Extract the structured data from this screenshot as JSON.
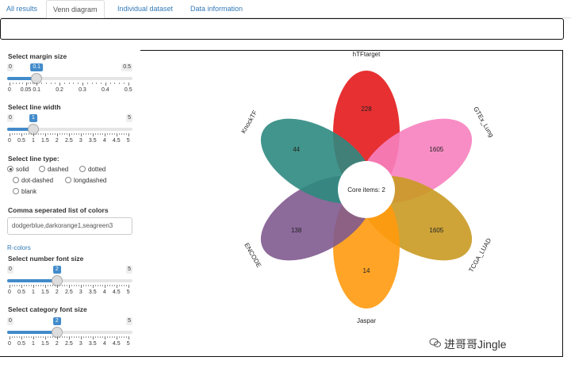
{
  "tabs": [
    "All results",
    "Venn diagram",
    "Individual dataset",
    "Data information"
  ],
  "active_tab": "Venn diagram",
  "margin_slider": {
    "label": "Select margin size",
    "min": "0",
    "max": "0.5",
    "value_label": "0.1",
    "value": 0.1,
    "range": [
      0,
      0.5
    ],
    "tick_labels": [
      "0",
      "0.05",
      "0.1",
      "0.2",
      "0.3",
      "0.4",
      "0.5"
    ],
    "tick_values": [
      0,
      0.05,
      0.1,
      0.2,
      0.3,
      0.4,
      0.5
    ]
  },
  "line_width_slider": {
    "label": "Select line width",
    "min": "0",
    "max": "5",
    "value_label": "1",
    "value": 1,
    "range": [
      0,
      5
    ],
    "tick_labels": [
      "0",
      "0.5",
      "1",
      "1.5",
      "2",
      "2.5",
      "3",
      "3.5",
      "4",
      "4.5",
      "5"
    ]
  },
  "line_type": {
    "label": "Select line type:",
    "options": [
      "solid",
      "dashed",
      "dotted",
      "dot-dashed",
      "longdashed",
      "blank"
    ],
    "selected": "solid"
  },
  "colors_input": {
    "label": "Comma seperated list of colors",
    "value": "dodgerblue,darkorange1,seagreen3"
  },
  "r_colors_link": "R-colors",
  "number_font_slider": {
    "label": "Select number font size",
    "min": "0",
    "max": "5",
    "value_label": "2",
    "value": 2,
    "range": [
      0,
      5
    ],
    "tick_labels": [
      "0",
      "0.5",
      "1",
      "1.5",
      "2",
      "2.5",
      "3",
      "3.5",
      "4",
      "4.5",
      "5"
    ]
  },
  "category_font_slider": {
    "label": "Select category font size",
    "min": "0",
    "max": "5",
    "value_label": "2",
    "value": 2,
    "range": [
      0,
      5
    ],
    "tick_labels": [
      "0",
      "0.5",
      "1",
      "1.5",
      "2",
      "2.5",
      "3",
      "3.5",
      "4",
      "4.5",
      "5"
    ]
  },
  "venn": {
    "center_label": "Core items: 2",
    "sets": [
      {
        "name": "hTFtarget",
        "count": "228",
        "color": "#e41a1c"
      },
      {
        "name": "GTEx_Lung",
        "count": "1605",
        "color": "#f781bf"
      },
      {
        "name": "TCGA_LUAD",
        "count": "1605",
        "color": "#c99a22"
      },
      {
        "name": "Jaspar",
        "count": "14",
        "color": "#ff9a0e"
      },
      {
        "name": "ENCODE",
        "count": "138",
        "color": "#7f5a8f"
      },
      {
        "name": "KnockTF",
        "count": "44",
        "color": "#2e8a80"
      }
    ]
  },
  "watermark": "进哥哥Jingle"
}
